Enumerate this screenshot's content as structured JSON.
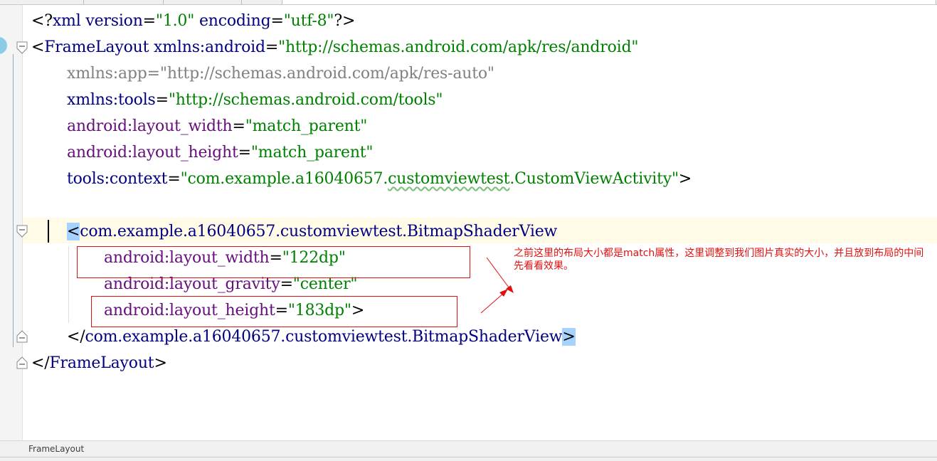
{
  "editor": {
    "lines": {
      "l1": {
        "open": "<?",
        "name": "xml",
        "a1": "version",
        "eq1": "=",
        "v1": "\"1.0\"",
        "a2": "encoding",
        "eq2": "=",
        "v2": "\"utf-8\"",
        "close": "?>"
      },
      "l2": {
        "open": "<",
        "name": "FrameLayout",
        "a1": "xmlns:android",
        "eq": "=",
        "v1": "\"http://schemas.android.com/apk/res/android\""
      },
      "l3": {
        "attr": "xmlns:app",
        "eq": "=",
        "val": "\"http://schemas.android.com/apk/res-auto\""
      },
      "l4": {
        "attr": "xmlns:tools",
        "eq": "=",
        "val": "\"http://schemas.android.com/tools\""
      },
      "l5": {
        "attr": "android:layout_width",
        "eq": "=",
        "val": "\"match_parent\""
      },
      "l6": {
        "attr": "android:layout_height",
        "eq": "=",
        "val": "\"match_parent\""
      },
      "l7": {
        "attr": "tools:context",
        "eq": "=",
        "val_pre": "\"com.example.a16040657.",
        "val_squig": "customviewtest",
        "val_post": ".CustomViewActivity\"",
        "close": ">"
      },
      "l9": {
        "open": "<",
        "name": "com.example.a16040657.customviewtest.BitmapShaderView"
      },
      "l10": {
        "attr": "android:layout_width",
        "eq": "=",
        "val": "\"122dp\""
      },
      "l11": {
        "attr": "android:layout_gravity",
        "eq": "=",
        "val": "\"center\""
      },
      "l12": {
        "attr": "android:layout_height",
        "eq": "=",
        "val": "\"183dp\"",
        "close": ">"
      },
      "l13": {
        "open": "</",
        "name": "com.example.a16040657.customviewtest.BitmapShaderView",
        "close": ">"
      },
      "l14": {
        "open": "</",
        "name": "FrameLayout",
        "close": ">"
      }
    }
  },
  "annotation": {
    "text": "之前这里的布局大小都是match属性，这里调整到我们图片真实的大小，并且放到布局的中间 先看看效果。"
  },
  "statusbar": {
    "breadcrumb": "FrameLayout"
  },
  "colors": {
    "tag": "#000080",
    "attr_namespace": "#660e7a",
    "value": "#008000",
    "annotation": "#e01010",
    "caret_line": "#fffbe6",
    "brace_highlight": "#a6d2ff"
  }
}
